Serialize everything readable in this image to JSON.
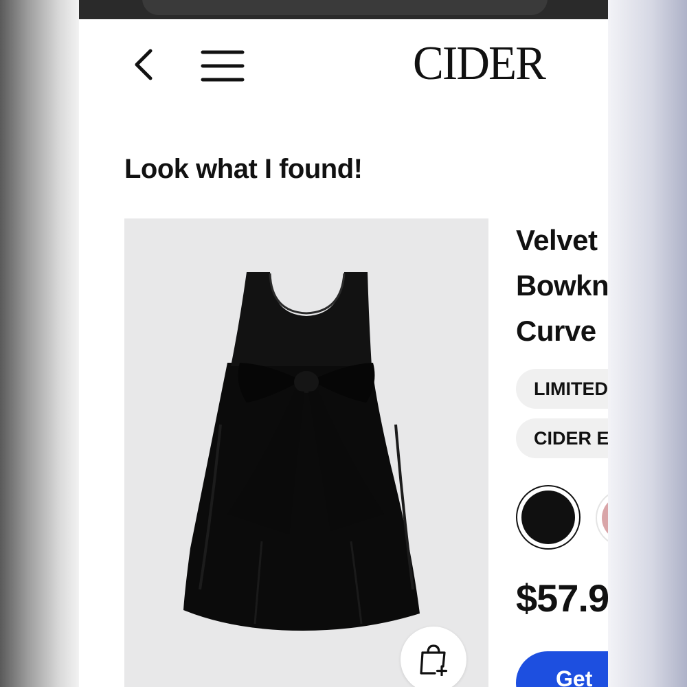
{
  "header": {
    "back_icon": "chevron-left-icon",
    "menu_icon": "hamburger-menu-icon",
    "logo": "CIDER"
  },
  "main": {
    "heading": "Look what I found!",
    "product": {
      "title_lines": [
        "Velvet",
        "Bowkn",
        "Curve"
      ],
      "tags": [
        "LIMITED",
        "CIDER E"
      ],
      "colors": [
        {
          "name": "black",
          "hex": "#101010",
          "selected": true
        },
        {
          "name": "pink",
          "hex": "#d9a5a8",
          "selected": false
        }
      ],
      "price": "$57.9",
      "cta_label": "Get",
      "add_to_bag_icon": "shopping-bag-plus-icon"
    }
  },
  "theme": {
    "accent": "#1d4fe0",
    "background": "#ffffff",
    "tag_background": "#f0f0f0"
  }
}
